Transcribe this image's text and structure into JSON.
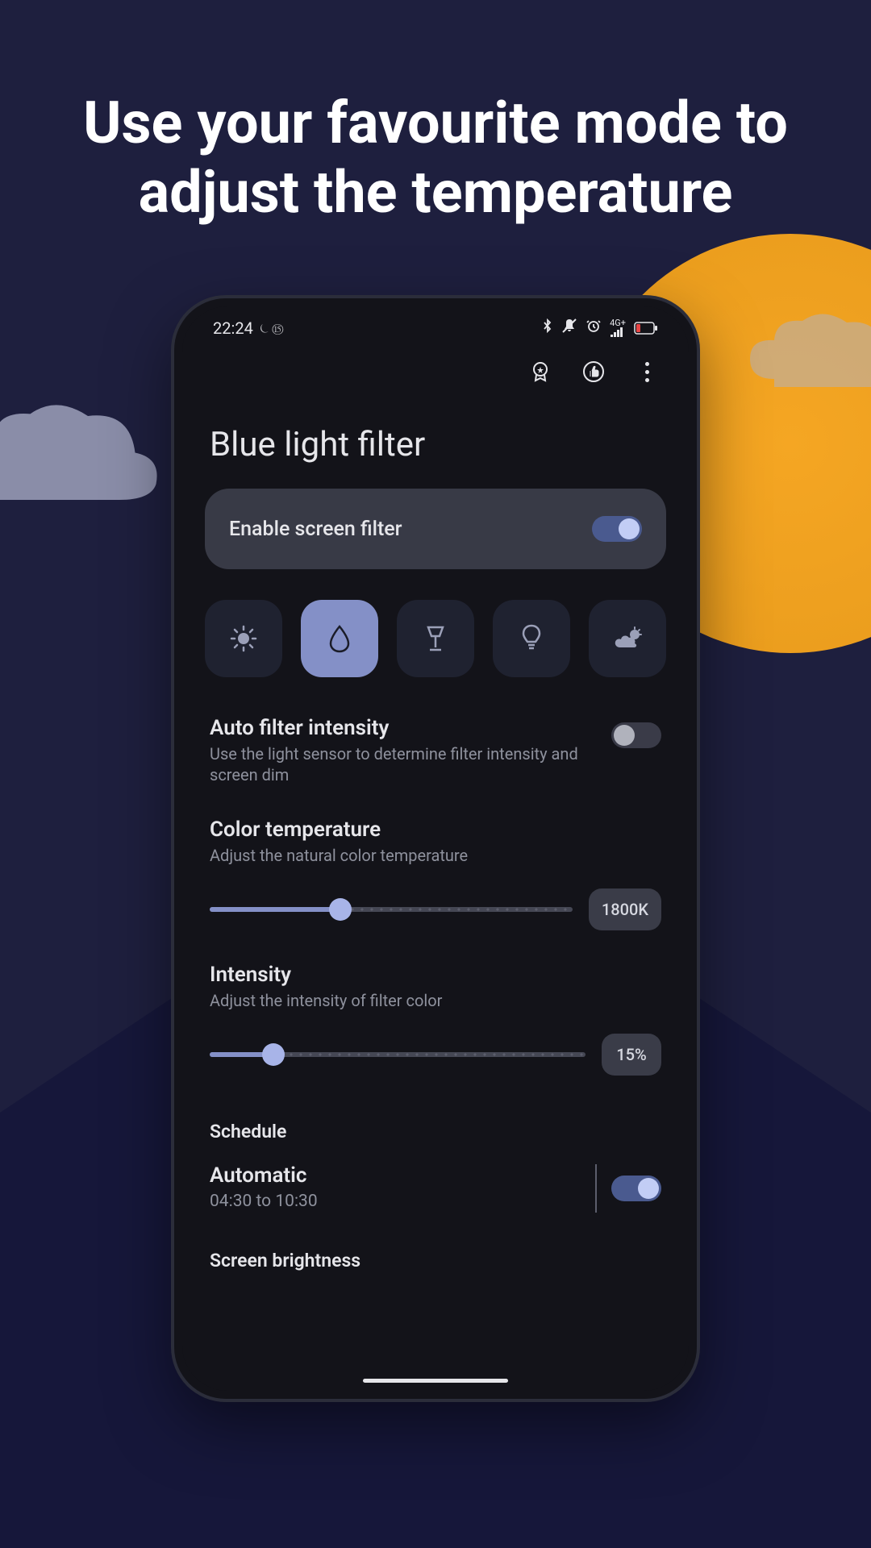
{
  "headline": "Use your favourite mode to adjust the temperature",
  "status": {
    "time": "22:24",
    "extras": "⏾ ⑮",
    "right": "✱ ⌀ ⏰ ⁴ᴳ⁺ 📶"
  },
  "page_title": "Blue light filter",
  "enable": {
    "label": "Enable screen filter",
    "on": true
  },
  "modes": [
    {
      "name": "sun-mode",
      "active": false
    },
    {
      "name": "drop-mode",
      "active": true
    },
    {
      "name": "lamp-mode",
      "active": false
    },
    {
      "name": "bulb-mode",
      "active": false
    },
    {
      "name": "cloud-mode",
      "active": false
    }
  ],
  "auto_intensity": {
    "title": "Auto filter intensity",
    "desc": "Use the light sensor to determine filter intensity and screen dim",
    "on": false
  },
  "color_temp": {
    "title": "Color temperature",
    "desc": "Adjust the natural color temperature",
    "value": "1800K",
    "percent": 36
  },
  "intensity": {
    "title": "Intensity",
    "desc": "Adjust the intensity of filter color",
    "value": "15%",
    "percent": 17
  },
  "schedule_header": "Schedule",
  "automatic": {
    "title": "Automatic",
    "desc": "04:30 to 10:30",
    "on": true
  },
  "brightness_header": "Screen brightness"
}
